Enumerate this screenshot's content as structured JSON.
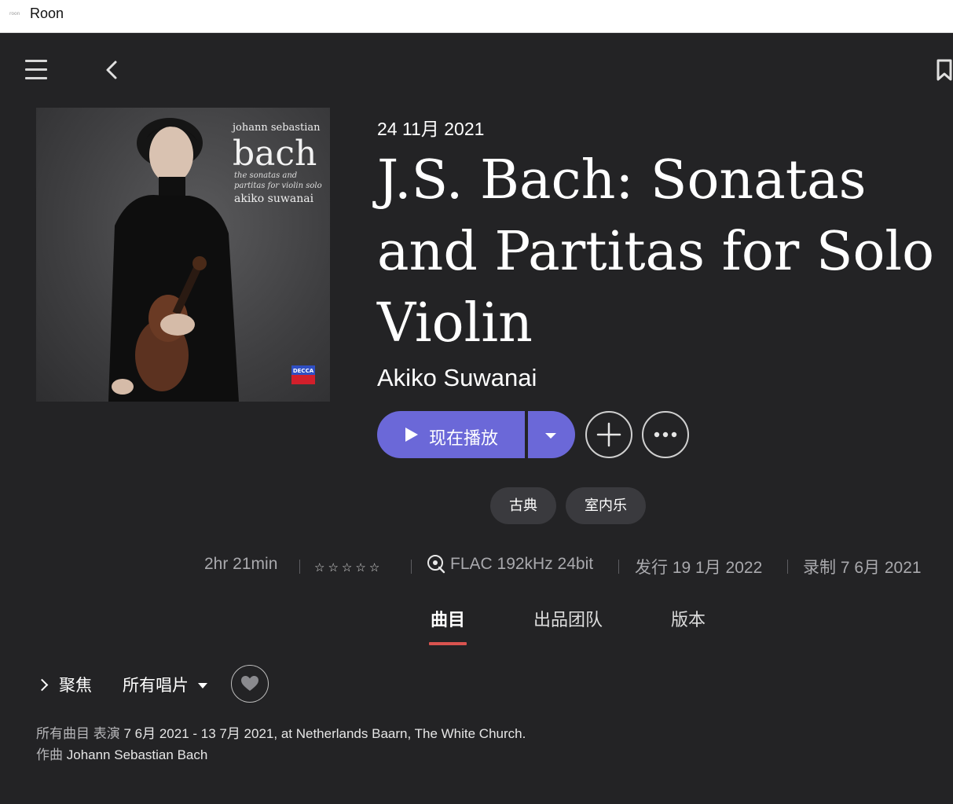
{
  "window": {
    "title": "Roon",
    "icon_label": "roon"
  },
  "nav": {
    "menu_icon": "hamburger-icon",
    "back_icon": "chevron-left-icon",
    "bookmark_icon": "bookmark-icon"
  },
  "album": {
    "cover": {
      "line1": "johann sebastian",
      "line2": "bach",
      "line3": "the sonatas and partitas for violin solo",
      "line4": "akiko suwanai",
      "label_logo": "DECCA"
    },
    "release_date": "24 11月 2021",
    "title": "J.S. Bach: Sonatas and Partitas for Solo Violin",
    "artist": "Akiko Suwanai"
  },
  "actions": {
    "play_label": "现在播放",
    "play_icon": "play-icon",
    "dropdown_icon": "caret-down-icon",
    "add_icon": "plus-icon",
    "more_icon": "ellipsis-icon"
  },
  "tags": [
    "古典",
    "室内乐"
  ],
  "info": {
    "duration": "2hr 21min",
    "rating_stars": 0,
    "rating_max": 5,
    "format": "FLAC 192kHz 24bit",
    "release": "发行 19 1月 2022",
    "recorded": "录制 7 6月 2021"
  },
  "tabs": [
    {
      "label": "曲目",
      "active": true
    },
    {
      "label": "出品团队",
      "active": false
    },
    {
      "label": "版本",
      "active": false
    }
  ],
  "toolbar": {
    "focus_label": "聚焦",
    "filter_label": "所有唱片",
    "heart_icon": "heart-icon"
  },
  "credits": {
    "line1_prefix": "所有曲目 表演",
    "line1_value": "7 6月 2021 - 13 7月 2021, at Netherlands Baarn, The White Church.",
    "line2_prefix": "作曲",
    "line2_value": "Johann Sebastian Bach"
  },
  "colors": {
    "background": "#232325",
    "accent": "#6b68d8",
    "tab_underline": "#d9534f",
    "tag_bg": "#3a3a3e"
  }
}
